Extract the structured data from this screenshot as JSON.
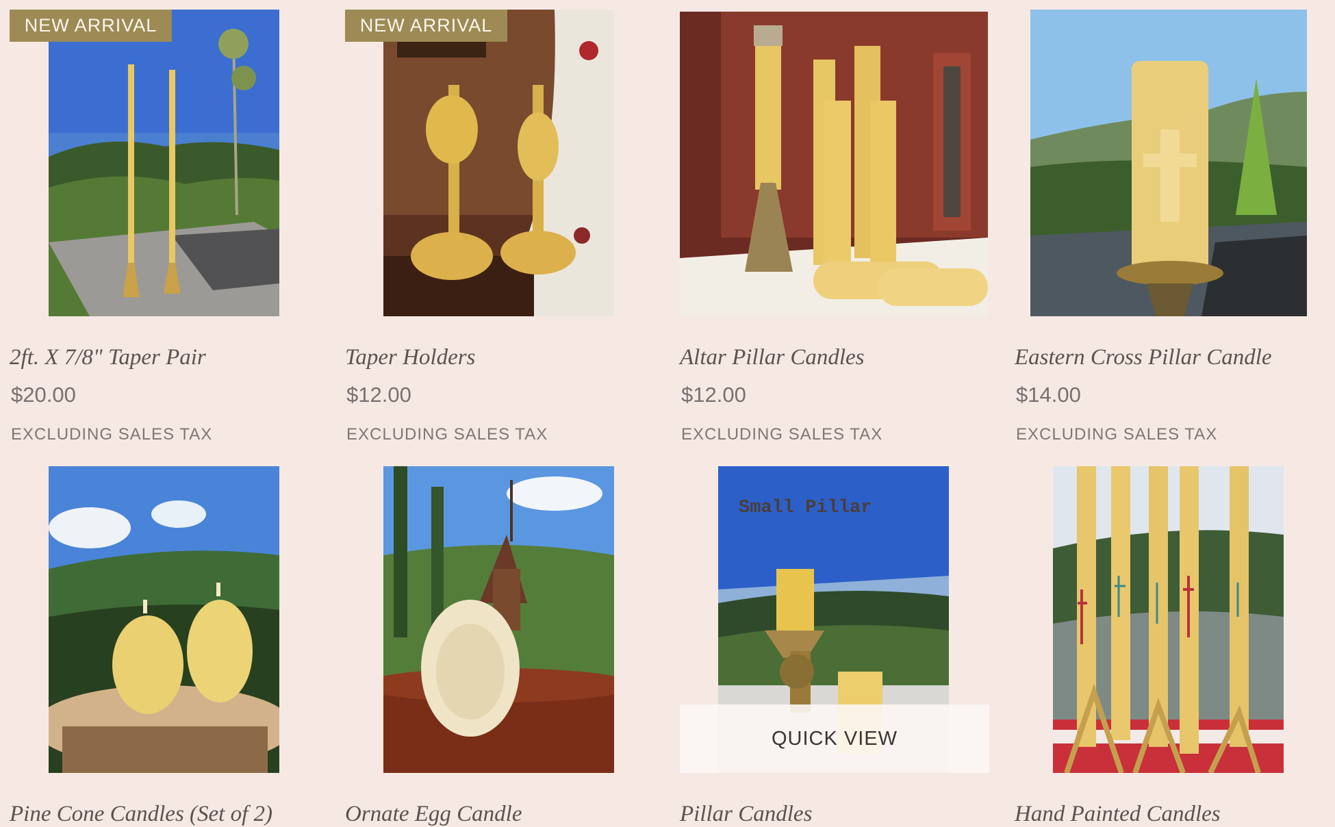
{
  "products": [
    {
      "title": "2ft. X 7/8\" Taper Pair",
      "price": "$20.00",
      "tax_note": "EXCLUDING SALES TAX",
      "ribbon": "NEW ARRIVAL"
    },
    {
      "title": "Taper Holders",
      "price": "$12.00",
      "tax_note": "EXCLUDING SALES TAX",
      "ribbon": "NEW ARRIVAL"
    },
    {
      "title": "Altar Pillar Candles",
      "price": "$12.00",
      "tax_note": "EXCLUDING SALES TAX"
    },
    {
      "title": "Eastern Cross Pillar Candle",
      "price": "$14.00",
      "tax_note": "EXCLUDING SALES TAX"
    },
    {
      "title": "Pine Cone Candles (Set of 2)"
    },
    {
      "title": "Ornate Egg Candle"
    },
    {
      "title": "Pillar Candles",
      "image_text": "Small Pillar",
      "quick_view": "QUICK VIEW"
    },
    {
      "title": "Hand Painted Candles"
    }
  ],
  "colors": {
    "background": "#f6e9e4",
    "ribbon": "#9d8a55",
    "beeswax": "#e9cf7e"
  }
}
